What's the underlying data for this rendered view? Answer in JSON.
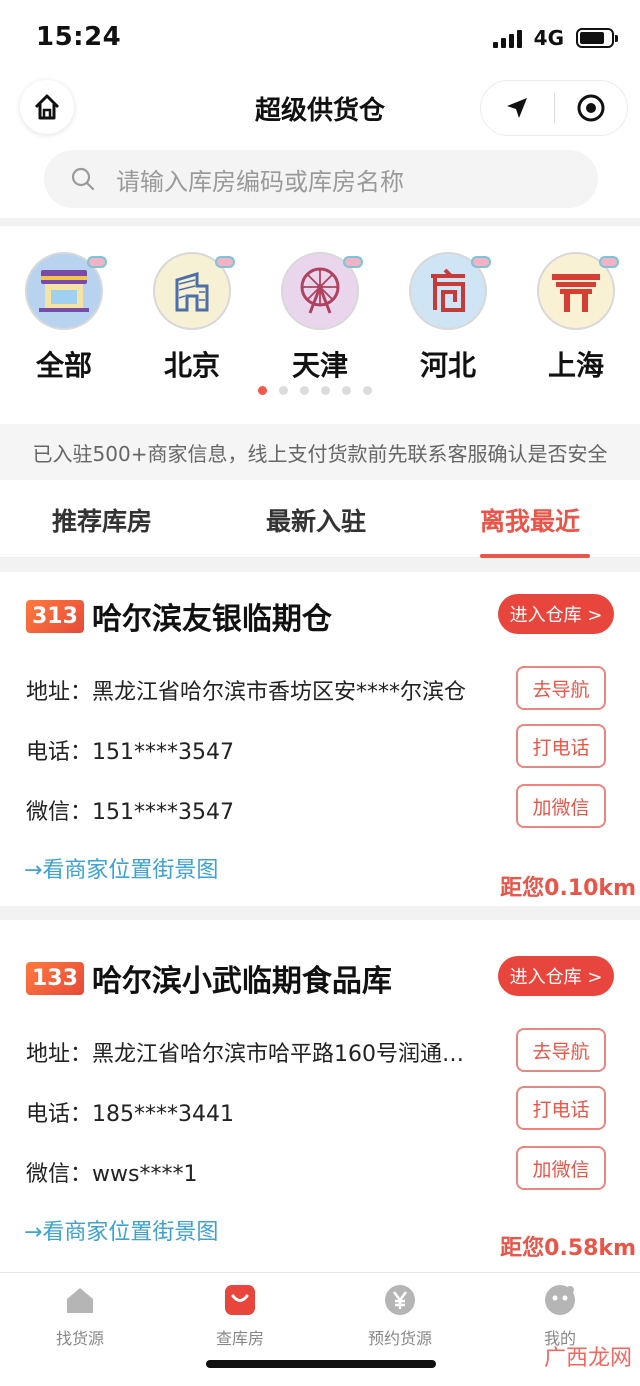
{
  "status": {
    "time": "15:24",
    "network": "4G"
  },
  "nav": {
    "title": "超级供货仓"
  },
  "search": {
    "placeholder": "请输入库房编码或库房名称"
  },
  "cities": [
    {
      "label": "全部",
      "icon": "shop-icon"
    },
    {
      "label": "北京",
      "icon": "cctv-tower-icon"
    },
    {
      "label": "天津",
      "icon": "ferris-wheel-icon"
    },
    {
      "label": "河北",
      "icon": "hebei-emblem-icon"
    },
    {
      "label": "上海",
      "icon": "china-pavilion-icon"
    }
  ],
  "carousel": {
    "pages": 6,
    "active": 0
  },
  "notice": "已入驻500+商家信息，线上支付货款前先联系客服确认是否安全",
  "tabs": [
    {
      "label": "推荐库房",
      "active": false
    },
    {
      "label": "最新入驻",
      "active": false
    },
    {
      "label": "离我最近",
      "active": true
    }
  ],
  "warehouses": [
    {
      "code": "313",
      "name": "哈尔滨友银临期仓",
      "enter_label": "进入仓库 >",
      "address": "地址：黑龙江省哈尔滨市香坊区安****尔滨仓",
      "phone": "电话：151****3547",
      "wechat": "微信：151****3547",
      "nav_label": "去导航",
      "call_label": "打电话",
      "wechat_label": "加微信",
      "street_label": "→看商家位置街景图",
      "distance": "距您0.10km"
    },
    {
      "code": "133",
      "name": "哈尔滨小武临期食品库",
      "enter_label": "进入仓库 >",
      "address": "地址：黑龙江省哈尔滨市哈平路160号润通…",
      "phone": "电话：185****3441",
      "wechat": "微信：wws****1",
      "nav_label": "去导航",
      "call_label": "打电话",
      "wechat_label": "加微信",
      "street_label": "→看商家位置街景图",
      "distance": "距您0.58km"
    }
  ],
  "tabbar": [
    {
      "label": "找货源",
      "icon": "home-icon",
      "active": false
    },
    {
      "label": "查库房",
      "icon": "bag-icon",
      "active": true
    },
    {
      "label": "预约货源",
      "icon": "yen-icon",
      "active": false
    },
    {
      "label": "我的",
      "icon": "profile-icon",
      "active": false
    }
  ],
  "watermark": "广西龙网",
  "colors": {
    "accent": "#e8453c",
    "link": "#3ea1d0"
  }
}
